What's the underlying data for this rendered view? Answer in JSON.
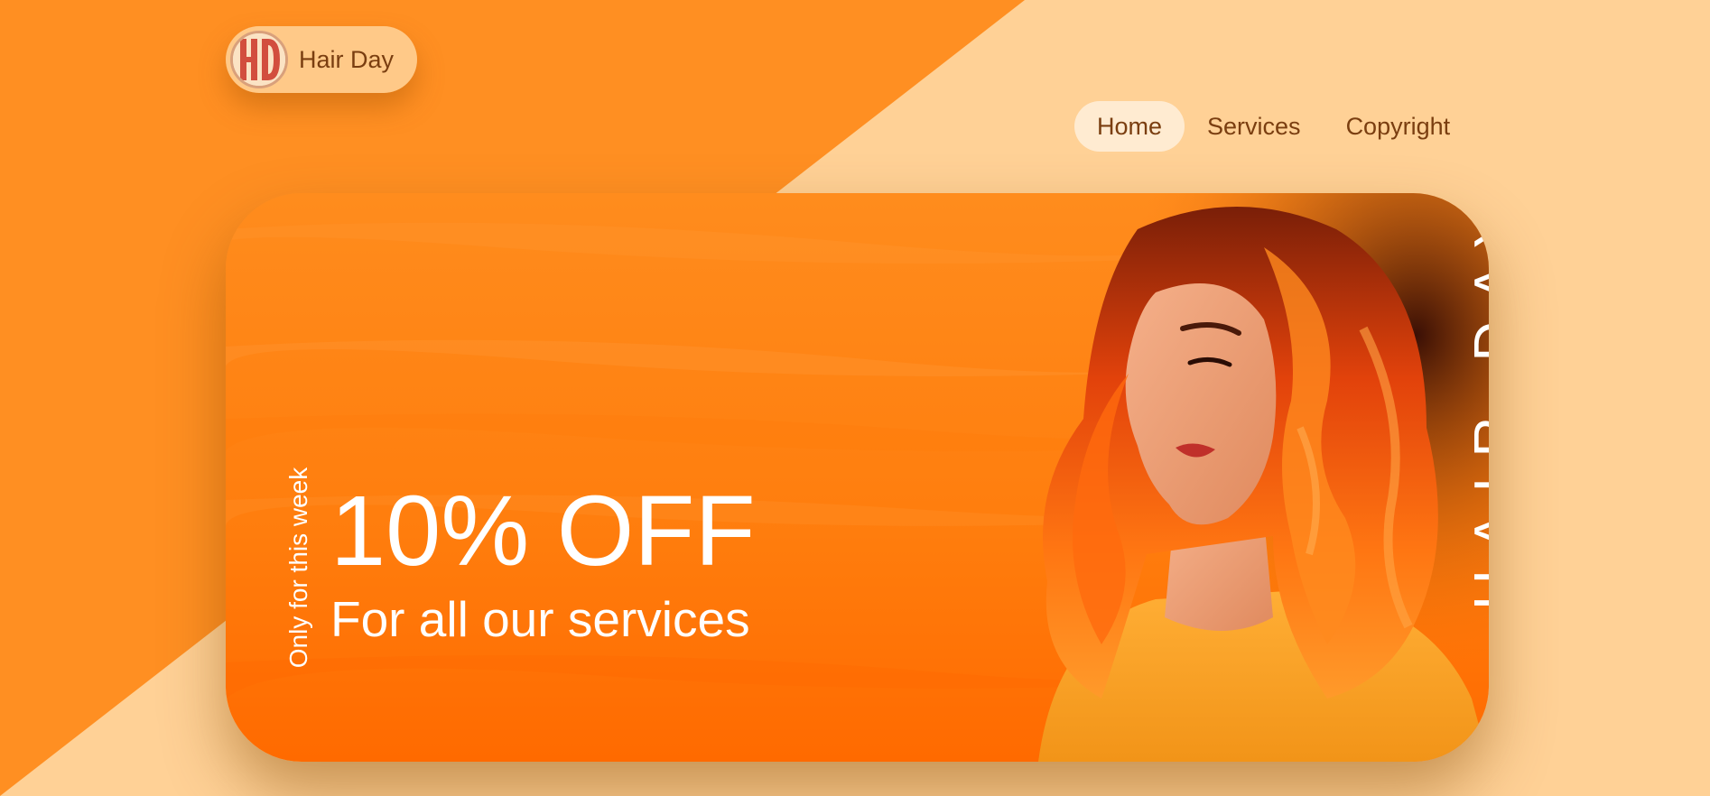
{
  "brand": {
    "logo_text": "Hair Day",
    "logo_monogram": "HD"
  },
  "nav": {
    "items": [
      {
        "label": "Home",
        "active": true
      },
      {
        "label": "Services",
        "active": false
      },
      {
        "label": "Copyright",
        "active": false
      }
    ]
  },
  "hero": {
    "tagline_vertical": "Only for this week",
    "offer_title": "10% OFF",
    "offer_subtitle": "For all our services",
    "brand_vertical": "HAIR DAY"
  },
  "colors": {
    "orange_primary": "#ff8c1d",
    "orange_deep": "#ff6a00",
    "peach_background": "#ffd196",
    "text_brown": "#7a3e10",
    "white": "#ffffff"
  }
}
